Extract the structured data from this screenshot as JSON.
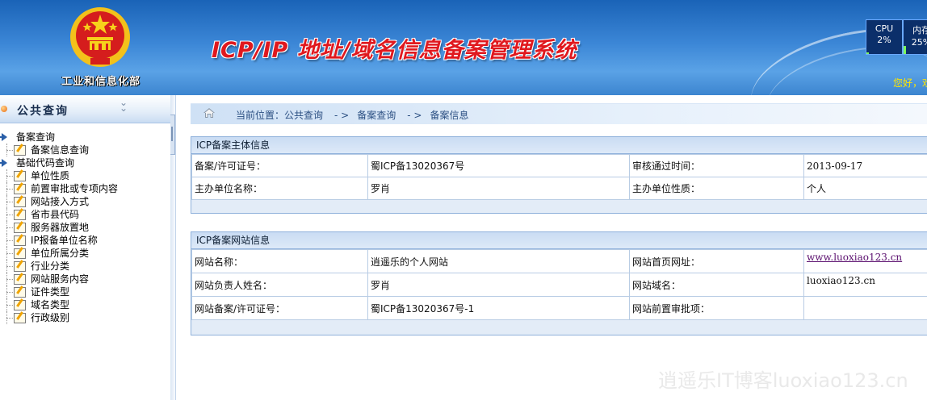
{
  "header": {
    "ministry": "工业和信息化部",
    "system_title": "ICP/IP 地址/域名信息备案管理系统",
    "cpu_label": "CPU",
    "cpu_value": "2%",
    "mem_label": "内存",
    "mem_value": "25%",
    "greeting": "您好，欢",
    "colors": {
      "title": "#e0181e",
      "header_bg": "#3b86d6",
      "greeting": "#ffe600"
    }
  },
  "sidebar": {
    "title": "公共查询",
    "tree": [
      {
        "type": "root",
        "label": "备案查询"
      },
      {
        "type": "leaf",
        "label": "备案信息查询"
      },
      {
        "type": "root",
        "label": "基础代码查询"
      },
      {
        "type": "leaf",
        "label": "单位性质"
      },
      {
        "type": "leaf",
        "label": "前置审批或专项内容"
      },
      {
        "type": "leaf",
        "label": "网站接入方式"
      },
      {
        "type": "leaf",
        "label": "省市县代码"
      },
      {
        "type": "leaf",
        "label": "服务器放置地"
      },
      {
        "type": "leaf",
        "label": "IP报备单位名称"
      },
      {
        "type": "leaf",
        "label": "单位所属分类"
      },
      {
        "type": "leaf",
        "label": "行业分类"
      },
      {
        "type": "leaf",
        "label": "网站服务内容"
      },
      {
        "type": "leaf",
        "label": "证件类型"
      },
      {
        "type": "leaf",
        "label": "域名类型"
      },
      {
        "type": "leaf",
        "label": "行政级别"
      }
    ]
  },
  "breadcrumb": {
    "prefix": "当前位置：",
    "items": [
      "公共查询",
      "备案查询",
      "备案信息"
    ],
    "separator": "- >"
  },
  "subject_panel": {
    "title": "ICP备案主体信息",
    "rows": [
      [
        "备案/许可证号：",
        "蜀ICP备13020367号",
        "审核通过时间：",
        "2013-09-17"
      ],
      [
        "主办单位名称：",
        "罗肖",
        "主办单位性质：",
        "个人"
      ]
    ]
  },
  "website_panel": {
    "title": "ICP备案网站信息",
    "rows": [
      [
        "网站名称：",
        "逍遥乐的个人网站",
        "网站首页网址：",
        "www.luoxiao123.cn"
      ],
      [
        "网站负责人姓名：",
        "罗肖",
        "网站域名：",
        "luoxiao123.cn"
      ],
      [
        "网站备案/许可证号：",
        "蜀ICP备13020367号-1",
        "网站前置审批项：",
        ""
      ]
    ]
  },
  "watermark": "逍遥乐IT博客luoxiao123.cn"
}
